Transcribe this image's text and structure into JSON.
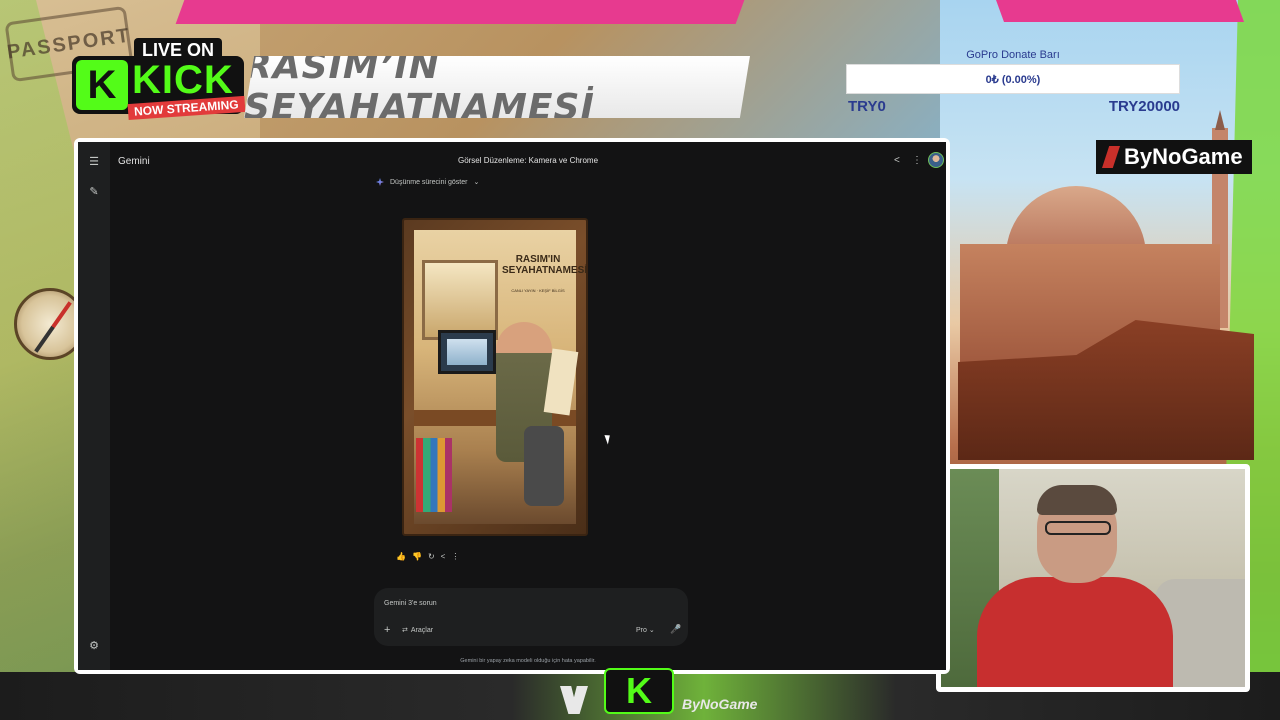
{
  "overlay": {
    "passport_stamp": "PASSPORT",
    "live_on": "LIVE ON",
    "kick_k": "K",
    "kick_word": "KICK",
    "now_streaming": "NOW STREAMING",
    "stream_title": "RASIM’İN SEYAHATNAMESİ",
    "sponsor_logo": "ByNoGame",
    "bottom_logo_k": "K",
    "bottom_logo_text": "ByNoGame"
  },
  "donate": {
    "title": "GoPro Donate Barı",
    "progress_text": "0₺ (0.00%)",
    "progress_fraction": 0.0,
    "min_label": "TRY0",
    "max_label": "TRY20000"
  },
  "gemini": {
    "app_name": "Gemini",
    "conversation_title": "Görsel Düzenleme: Kamera ve Chrome",
    "thinking_toggle": "Düşünme sürecini göster",
    "poster": {
      "title_line1": "RASIM'IN",
      "title_line2": "SEYAHATNAMESİ",
      "subtitle": "CANLI YAYIN · KEŞİF BİLGİS"
    },
    "prompt_placeholder": "Gemini 3'e sorun",
    "tools_label": "Araçlar",
    "model_label": "Pro",
    "disclaimer": "Gemini bir yapay zeka modeli olduğu için hata yapabilir."
  },
  "icons": {
    "menu": "☰",
    "new_chat": "✎",
    "settings": "⚙",
    "share": "<",
    "more": "⋮",
    "plus": "+",
    "mic": "🎤",
    "chevron": "⌄",
    "tools": "⇄",
    "like": "👍",
    "dislike": "👎",
    "redo": "↻",
    "share_small": "<",
    "more_small": "⋮"
  }
}
